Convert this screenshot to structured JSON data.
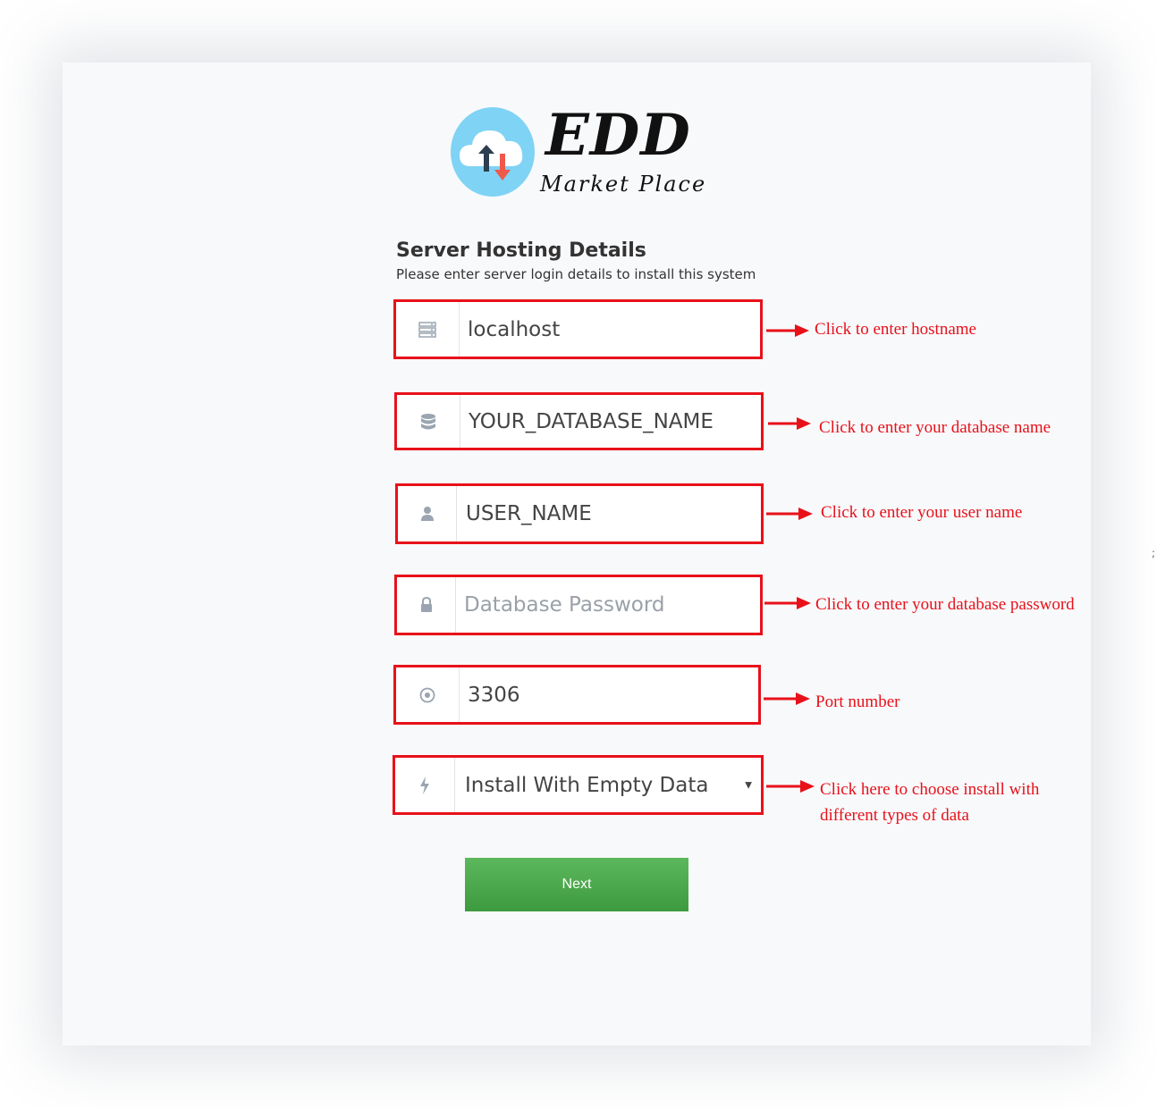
{
  "logo": {
    "title": "EDD",
    "subtitle": "Market Place"
  },
  "form": {
    "title": "Server Hosting Details",
    "subtitle": "Please enter server login details to install this system",
    "fields": [
      {
        "icon": "server-icon",
        "value": "localhost",
        "placeholder": ""
      },
      {
        "icon": "database-icon",
        "value": "YOUR_DATABASE_NAME",
        "placeholder": ""
      },
      {
        "icon": "user-icon",
        "value": "USER_NAME",
        "placeholder": ""
      },
      {
        "icon": "lock-icon",
        "value": "",
        "placeholder": "Database Password"
      },
      {
        "icon": "port-icon",
        "value": "3306",
        "placeholder": ""
      },
      {
        "icon": "bolt-icon",
        "value": "Install With Empty Data",
        "placeholder": ""
      }
    ],
    "next_label": "Next"
  },
  "annotations": [
    "Click to enter hostname",
    "Click to enter your database name",
    "Click to enter your user name",
    "Click to enter your database password",
    "Port number",
    "Click here to choose install with",
    "different types of data"
  ],
  "stray_mark": ";",
  "colors": {
    "annotation": "#e8111a",
    "button": "#4cae4c",
    "logo_circle": "#7fd3f5"
  }
}
